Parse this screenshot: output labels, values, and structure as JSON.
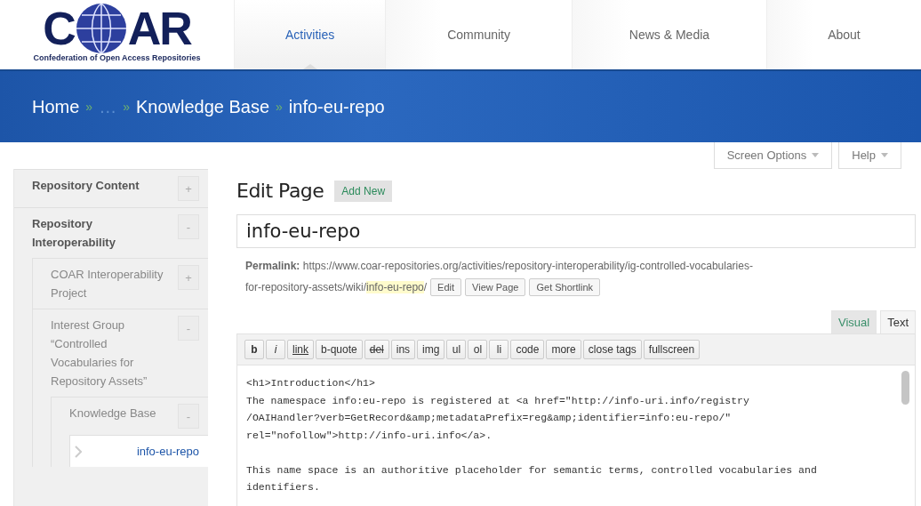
{
  "logo": {
    "left": "C",
    "right": "AR",
    "tagline": "Confederation of Open Access Repositories"
  },
  "nav": [
    {
      "label": "Activities",
      "selected": true
    },
    {
      "label": "Community",
      "selected": false
    },
    {
      "label": "News & Media",
      "selected": false
    },
    {
      "label": "About",
      "selected": false
    }
  ],
  "breadcrumb": {
    "separator": "»",
    "items": [
      {
        "label": "Home",
        "kind": "link"
      },
      {
        "label": "…",
        "kind": "faded"
      },
      {
        "label": "Knowledge Base",
        "kind": "link"
      },
      {
        "label": "info-eu-repo",
        "kind": "current"
      }
    ]
  },
  "screen_tabs": [
    "Screen Options",
    "Help"
  ],
  "sidebar": [
    {
      "label": "Repository Content",
      "toggle": "+",
      "selected": false
    },
    {
      "label": "Repository Interoperability",
      "toggle": "-",
      "selected": false,
      "children": [
        {
          "label": "COAR Interoperability Project",
          "toggle": "+",
          "selected": false
        },
        {
          "label": "Interest Group “Controlled Vocabularies for Repository Assets”",
          "toggle": "-",
          "selected": false,
          "children": [
            {
              "label": "Knowledge Base",
              "toggle": "-",
              "selected": false,
              "children": [
                {
                  "label": "info-eu-repo",
                  "selected": true
                }
              ]
            }
          ]
        }
      ]
    }
  ],
  "heading": "Edit Page",
  "add_new": "Add New",
  "title_value": "info-eu-repo",
  "permalink": {
    "label": "Permalink:",
    "url_line_1": "https://www.coar-repositories.org/activities/repository-interoperability/ig-controlled-vocabularies-",
    "url_line_2": "for-repository-assets/wiki/",
    "slug": "info-eu-repo",
    "end": "/",
    "buttons": [
      "Edit",
      "View Page",
      "Get Shortlink"
    ]
  },
  "editor_tabs": [
    {
      "label": "Visual",
      "selected": false
    },
    {
      "label": "Text",
      "selected": true
    }
  ],
  "toolbar": [
    {
      "label": "b",
      "kind": "bold"
    },
    {
      "label": "i",
      "kind": "italic"
    },
    {
      "label": "link",
      "kind": "underline"
    },
    {
      "label": "b-quote",
      "kind": "plain"
    },
    {
      "label": "del",
      "kind": "strike"
    },
    {
      "label": "ins",
      "kind": "plain"
    },
    {
      "label": "img",
      "kind": "plain"
    },
    {
      "label": "ul",
      "kind": "plain"
    },
    {
      "label": "ol",
      "kind": "plain"
    },
    {
      "label": "li",
      "kind": "plain"
    },
    {
      "label": "code",
      "kind": "plain"
    },
    {
      "label": "more",
      "kind": "plain"
    },
    {
      "label": "close tags",
      "kind": "plain"
    },
    {
      "label": "fullscreen",
      "kind": "plain"
    }
  ],
  "content_paragraphs": [
    [
      "<h1>Introduction</h1>",
      "The namespace info:eu-repo is registered at <a href=\"http://info-uri.info/registry",
      "/OAIHandler?verb=GetRecord&amp;metadataPrefix=reg&amp;identifier=info:eu-repo/\"",
      "rel=\"nofollow\">http://info-uri.info</a>."
    ],
    [
      "This name space is an authoritive placeholder for semantic terms, controlled vocabularies and",
      "identifiers."
    ]
  ]
}
